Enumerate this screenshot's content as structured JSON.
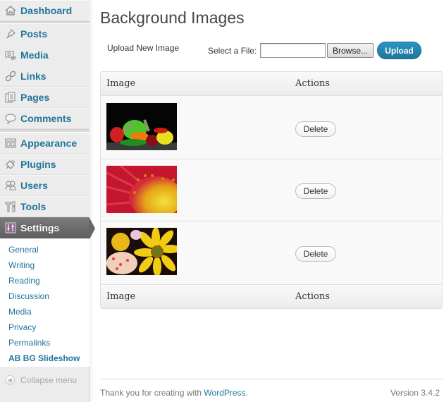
{
  "sidebar": {
    "items": [
      {
        "label": "Dashboard",
        "icon": "home-icon"
      },
      {
        "label": "Posts",
        "icon": "pushpin-icon"
      },
      {
        "label": "Media",
        "icon": "media-icon"
      },
      {
        "label": "Links",
        "icon": "link-icon"
      },
      {
        "label": "Pages",
        "icon": "pages-icon"
      },
      {
        "label": "Comments",
        "icon": "comment-icon"
      },
      {
        "label": "Appearance",
        "icon": "appearance-icon"
      },
      {
        "label": "Plugins",
        "icon": "plugin-icon"
      },
      {
        "label": "Users",
        "icon": "users-icon"
      },
      {
        "label": "Tools",
        "icon": "tools-icon"
      },
      {
        "label": "Settings",
        "icon": "settings-icon",
        "active": true
      }
    ],
    "submenu": [
      {
        "label": "General"
      },
      {
        "label": "Writing"
      },
      {
        "label": "Reading"
      },
      {
        "label": "Discussion"
      },
      {
        "label": "Media"
      },
      {
        "label": "Privacy"
      },
      {
        "label": "Permalinks"
      },
      {
        "label": "AB BG Slideshow",
        "current": true
      }
    ],
    "collapse_label": "Collapse menu"
  },
  "main": {
    "title": "Background Images",
    "upload_section_label": "Upload New Image",
    "select_file_label": "Select a File:",
    "file_input_value": "",
    "browse_label": "Browse...",
    "upload_label": "Upload",
    "table": {
      "columns": [
        "Image",
        "Actions"
      ],
      "rows": [
        {
          "image": "vegetables-thumbnail",
          "action_label": "Delete"
        },
        {
          "image": "red-flower-thumbnail",
          "action_label": "Delete"
        },
        {
          "image": "sunflower-bouquet-thumbnail",
          "action_label": "Delete"
        }
      ]
    }
  },
  "footer": {
    "thanks_prefix": "Thank you for creating with ",
    "thanks_link": "WordPress",
    "thanks_suffix": ".",
    "version": "Version 3.4.2"
  },
  "colors": {
    "accent": "#21759b",
    "active_menu": "#6d6d6d",
    "upload_button": "#2a95c5"
  }
}
